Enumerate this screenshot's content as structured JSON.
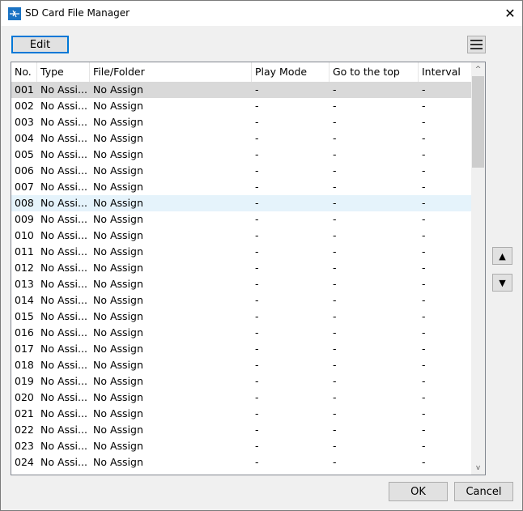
{
  "window": {
    "title": "SD Card File Manager",
    "close_glyph": "✕"
  },
  "toolbar": {
    "edit_label": "Edit"
  },
  "table": {
    "columns": [
      "No.",
      "Type",
      "File/Folder",
      "Play Mode",
      "Go to the top",
      "Interval"
    ],
    "selected_row": "001",
    "hovered_row": "008",
    "rows": [
      [
        "001",
        "No Assi...",
        "No Assign",
        "-",
        "-",
        "-"
      ],
      [
        "002",
        "No Assi...",
        "No Assign",
        "-",
        "-",
        "-"
      ],
      [
        "003",
        "No Assi...",
        "No Assign",
        "-",
        "-",
        "-"
      ],
      [
        "004",
        "No Assi...",
        "No Assign",
        "-",
        "-",
        "-"
      ],
      [
        "005",
        "No Assi...",
        "No Assign",
        "-",
        "-",
        "-"
      ],
      [
        "006",
        "No Assi...",
        "No Assign",
        "-",
        "-",
        "-"
      ],
      [
        "007",
        "No Assi...",
        "No Assign",
        "-",
        "-",
        "-"
      ],
      [
        "008",
        "No Assi...",
        "No Assign",
        "-",
        "-",
        "-"
      ],
      [
        "009",
        "No Assi...",
        "No Assign",
        "-",
        "-",
        "-"
      ],
      [
        "010",
        "No Assi...",
        "No Assign",
        "-",
        "-",
        "-"
      ],
      [
        "011",
        "No Assi...",
        "No Assign",
        "-",
        "-",
        "-"
      ],
      [
        "012",
        "No Assi...",
        "No Assign",
        "-",
        "-",
        "-"
      ],
      [
        "013",
        "No Assi...",
        "No Assign",
        "-",
        "-",
        "-"
      ],
      [
        "014",
        "No Assi...",
        "No Assign",
        "-",
        "-",
        "-"
      ],
      [
        "015",
        "No Assi...",
        "No Assign",
        "-",
        "-",
        "-"
      ],
      [
        "016",
        "No Assi...",
        "No Assign",
        "-",
        "-",
        "-"
      ],
      [
        "017",
        "No Assi...",
        "No Assign",
        "-",
        "-",
        "-"
      ],
      [
        "018",
        "No Assi...",
        "No Assign",
        "-",
        "-",
        "-"
      ],
      [
        "019",
        "No Assi...",
        "No Assign",
        "-",
        "-",
        "-"
      ],
      [
        "020",
        "No Assi...",
        "No Assign",
        "-",
        "-",
        "-"
      ],
      [
        "021",
        "No Assi...",
        "No Assign",
        "-",
        "-",
        "-"
      ],
      [
        "022",
        "No Assi...",
        "No Assign",
        "-",
        "-",
        "-"
      ],
      [
        "023",
        "No Assi...",
        "No Assign",
        "-",
        "-",
        "-"
      ],
      [
        "024",
        "No Assi...",
        "No Assign",
        "-",
        "-",
        "-"
      ]
    ]
  },
  "scrollbar": {
    "up_glyph": "^",
    "down_glyph": "v"
  },
  "side": {
    "up_glyph": "▲",
    "down_glyph": "▼"
  },
  "footer": {
    "ok_label": "OK",
    "cancel_label": "Cancel"
  }
}
